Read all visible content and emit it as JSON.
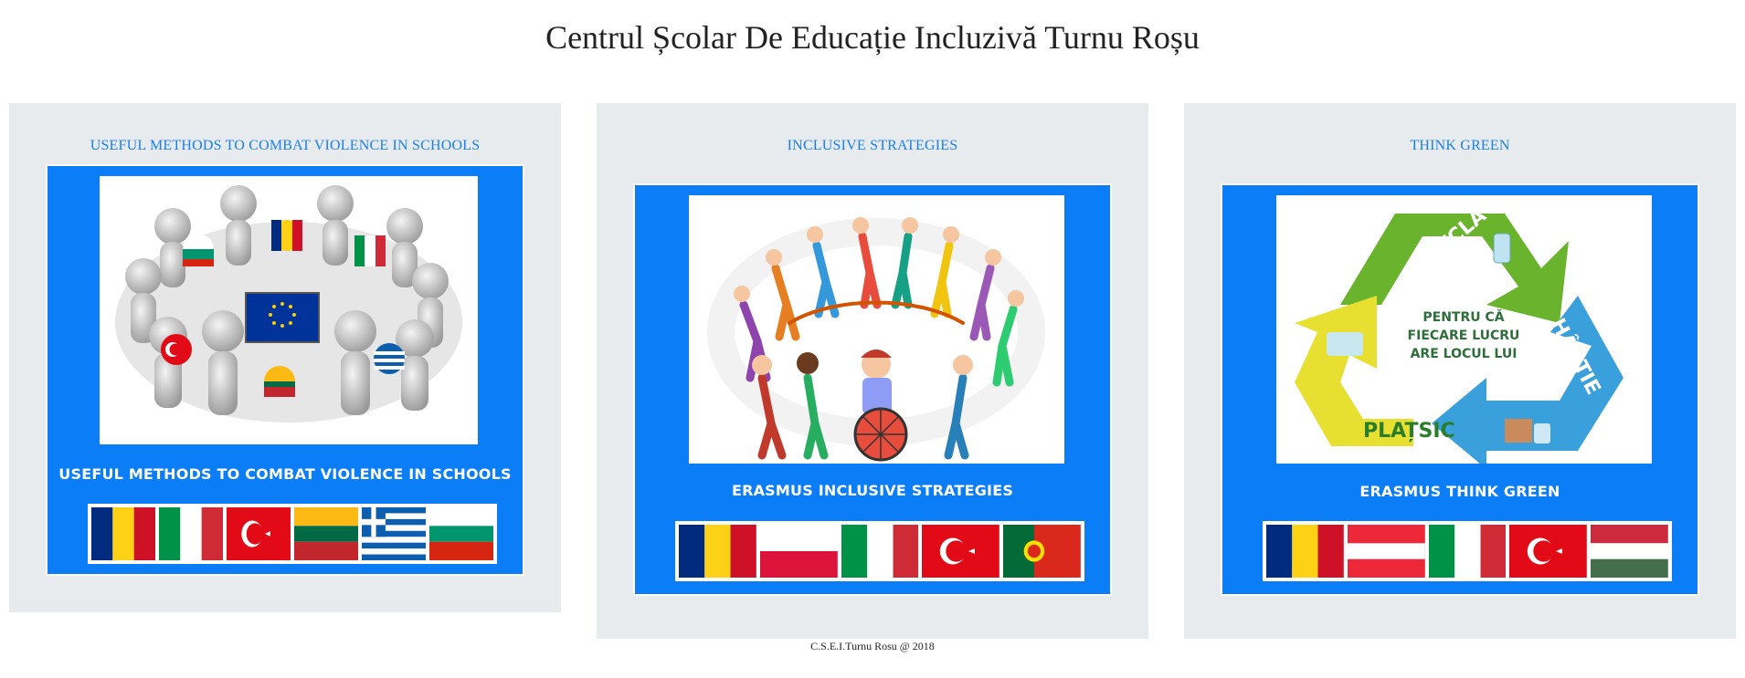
{
  "header": {
    "title": "Centrul Școlar De Educație Incluzivă Turnu Roșu"
  },
  "cards": [
    {
      "title": "USEFUL METHODS TO COMBAT VIOLENCE IN SCHOOLS",
      "caption": "USEFUL METHODS TO COMBAT VIOLENCE IN SCHOOLS",
      "flags": [
        "romania",
        "italy",
        "turkey",
        "lithuania",
        "greece",
        "bulgaria"
      ]
    },
    {
      "title": "INCLUSIVE STRATEGIES",
      "caption": "ERASMUS INCLUSIVE STRATEGIES",
      "flags": [
        "romania",
        "poland",
        "italy",
        "turkey",
        "portugal"
      ]
    },
    {
      "title": "THINK GREEN",
      "caption": "ERASMUS THINK GREEN",
      "poster_text": {
        "center": [
          "PENTRU CĂ",
          "FIECARE LUCRU",
          "ARE LOCUL LUI"
        ],
        "glass": "SITCLĂ",
        "paper": "HÂRȚIE",
        "plastic": "PLAȚSIC"
      },
      "flags": [
        "romania",
        "austria",
        "italy",
        "turkey",
        "hungary"
      ]
    }
  ],
  "footer": {
    "text": "C.S.E.I.Turnu Rosu @ 2018"
  },
  "colors": {
    "poster_blue": "#0a7df7",
    "link_blue": "#1a7ff0",
    "card_bg": "#e8ebee"
  }
}
